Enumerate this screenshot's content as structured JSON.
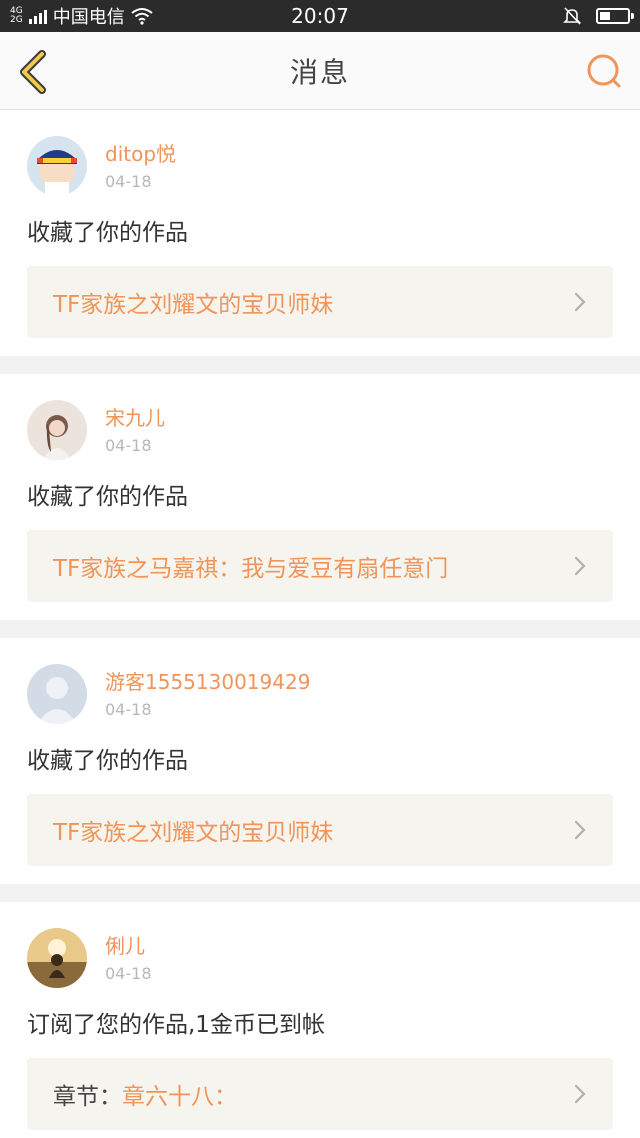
{
  "status_bar": {
    "network_top": "4G",
    "network_bottom": "2G",
    "carrier": "中国电信",
    "time": "20:07",
    "battery_level": 0.4,
    "icons": [
      "signal-icon",
      "wifi-icon",
      "silent-bell-icon",
      "battery-icon"
    ]
  },
  "header": {
    "title": "消息",
    "back_icon": "chevron-left-icon",
    "search_icon": "search-icon"
  },
  "colors": {
    "accent": "#f0945a",
    "back_icon": "#f2c94c",
    "card_bg": "#ffffff",
    "work_bg": "#f6f4ee"
  },
  "messages": [
    {
      "username": "ditop悦",
      "date": "04-18",
      "action": "收藏了你的作品",
      "work_prefix": "",
      "work_title": "TF家族之刘耀文的宝贝师妹"
    },
    {
      "username": "宋九儿",
      "date": "04-18",
      "action": "收藏了你的作品",
      "work_prefix": "",
      "work_title": "TF家族之马嘉祺：我与爱豆有扇任意门"
    },
    {
      "username": "游客1555130019429",
      "date": "04-18",
      "action": "收藏了你的作品",
      "work_prefix": "",
      "work_title": "TF家族之刘耀文的宝贝师妹"
    },
    {
      "username": "俐儿",
      "date": "04-18",
      "action": "订阅了您的作品,1金币已到帐",
      "work_prefix": "章节：",
      "work_title": "章六十八："
    }
  ]
}
